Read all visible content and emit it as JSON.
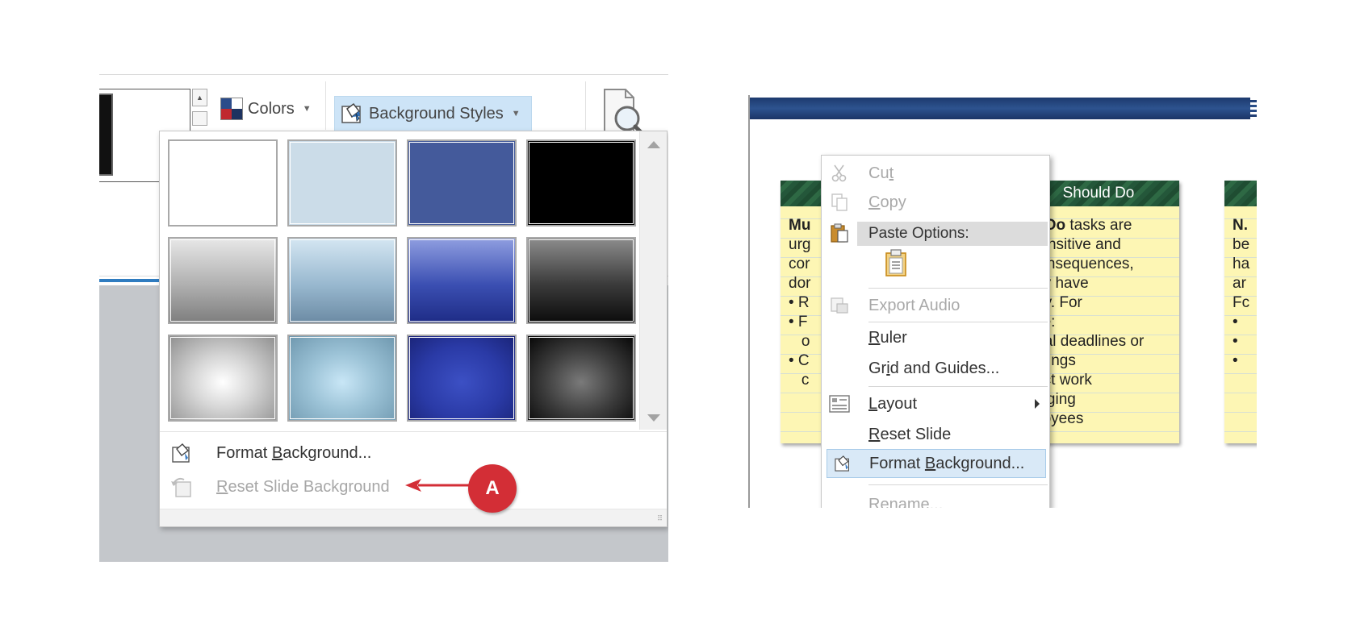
{
  "left_panel": {
    "ribbon": {
      "colors_label": "Colors",
      "background_styles_label": "Background Styles"
    },
    "swatches": [
      {
        "name": "style-1",
        "fill": "#ffffff"
      },
      {
        "name": "style-2",
        "fill": "#cbdce8"
      },
      {
        "name": "style-3",
        "fill": "#445a9b"
      },
      {
        "name": "style-4",
        "fill": "#000000"
      },
      {
        "name": "style-5",
        "fill": "linear-gradient(180deg,#e7e7e7 0%,#b0b0b0 55%,#7e7e7e 100%)"
      },
      {
        "name": "style-6",
        "fill": "linear-gradient(180deg,#d4e6f2 0%,#98b8cf 55%,#6c8ba4 100%)"
      },
      {
        "name": "style-7",
        "fill": "linear-gradient(180deg,#8f9ee0 0%,#3b4fb2 55%,#1e2c86 100%)"
      },
      {
        "name": "style-8",
        "fill": "linear-gradient(180deg,#8c8c8c 0%,#3a3a3a 55%,#0c0c0c 100%)"
      },
      {
        "name": "style-9",
        "fill": "radial-gradient(ellipse at 50% 55%,#ffffff 0%,#d6d6d6 40%,#8e8e8e 100%)"
      },
      {
        "name": "style-10",
        "fill": "radial-gradient(ellipse at 50% 55%,#c8e6f6 0%,#9bc2d6 45%,#6e97ae 100%)"
      },
      {
        "name": "style-11",
        "fill": "radial-gradient(ellipse at 50% 55%,#3c50c4 0%,#2a3aa6 55%,#1a2478 100%)"
      },
      {
        "name": "style-12",
        "fill": "radial-gradient(ellipse at 50% 55%,#7a7a7a 0%,#3c3c3c 50%,#050505 100%)"
      }
    ],
    "menu": {
      "format_background": {
        "pre": "Format ",
        "ul": "B",
        "post": "ackground..."
      },
      "reset_background": {
        "pre": "",
        "ul": "R",
        "post": "eset Slide Background"
      }
    },
    "callout_label": "A"
  },
  "right_panel": {
    "notes": {
      "left_partial": {
        "header": "",
        "lines": [
          "Mu",
          "urg",
          "cor",
          "dor",
          "• R",
          "• F",
          "   o",
          "• C",
          "   c"
        ]
      },
      "middle": {
        "header": "Should Do",
        "lines": [
          "uld Do tasks are",
          "e-sensitive and",
          "e consequences,",
          " may have",
          "ibility. For",
          "mple:",
          "ternal deadlines or",
          "neetings",
          "roject work",
          "lanaging",
          "mployees"
        ]
      },
      "right_partial": {
        "header": "",
        "lines": [
          "N.",
          "be",
          "ha",
          "ar",
          "Fc",
          "•",
          "•",
          "•"
        ]
      }
    },
    "context_menu": {
      "cut": {
        "pre": "Cu",
        "ul": "t",
        "post": ""
      },
      "copy": {
        "pre": "",
        "ul": "C",
        "post": "opy"
      },
      "paste_options": "Paste Options:",
      "export_audio": "Export Audio",
      "ruler": {
        "pre": "",
        "ul": "R",
        "post": "uler"
      },
      "grid": {
        "pre": "Gr",
        "ul": "i",
        "post": "d and Guides..."
      },
      "layout": {
        "pre": "",
        "ul": "L",
        "post": "ayout"
      },
      "reset_slide": {
        "pre": "",
        "ul": "R",
        "post": "eset Slide"
      },
      "format_background": {
        "pre": "Format ",
        "ul": "B",
        "post": "ackground..."
      },
      "rename": "Rename..."
    }
  },
  "colors": {
    "accent_blue": "#cde4f7",
    "callout_red": "#d32e36",
    "note_yellow": "#fdf6b4",
    "header_green": "#2e6944"
  }
}
